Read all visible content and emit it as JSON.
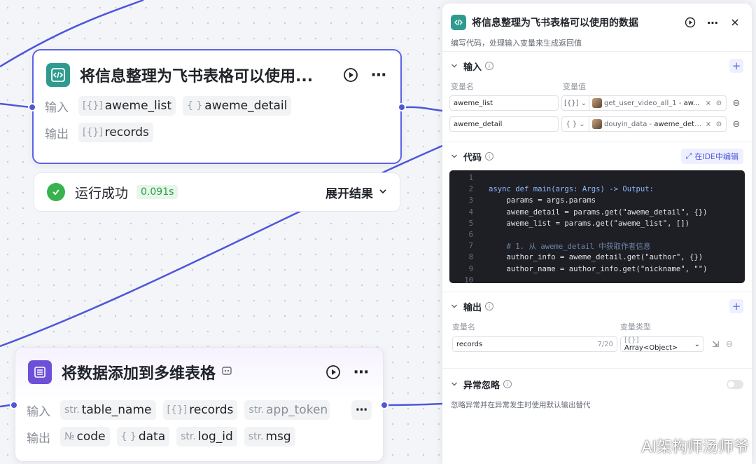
{
  "colors": {
    "accent": "#4e57d8",
    "success": "#37b24d",
    "code_icon": "#2f9b8f",
    "table_icon": "#6e4fd8"
  },
  "node_code": {
    "title": "将信息整理为飞书表格可以使用...",
    "input_label": "输入",
    "output_label": "输出",
    "inputs": [
      {
        "type_icon": "[{}]",
        "name": "aweme_list"
      },
      {
        "type_icon": "{ }",
        "name": "aweme_detail"
      }
    ],
    "outputs": [
      {
        "type_icon": "[{}]",
        "name": "records"
      }
    ]
  },
  "run_status": {
    "text": "运行成功",
    "time": "0.091s",
    "expand_label": "展开结果"
  },
  "node_table": {
    "title": "将数据添加到多维表格",
    "input_label": "输入",
    "output_label": "输出",
    "inputs": [
      {
        "type_icon": "str.",
        "name": "table_name"
      },
      {
        "type_icon": "[{}]",
        "name": "records"
      },
      {
        "type_icon": "str.",
        "name": "app_token"
      }
    ],
    "outputs": [
      {
        "type_icon": "№",
        "name": "code"
      },
      {
        "type_icon": "{ }",
        "name": "data"
      },
      {
        "type_icon": "str.",
        "name": "log_id"
      },
      {
        "type_icon": "str.",
        "name": "msg"
      }
    ]
  },
  "panel": {
    "title": "将信息整理为飞书表格可以使用的数据",
    "description": "编写代码，处理输入变量来生成返回值",
    "input_section": {
      "title": "输入",
      "col_name": "变量名",
      "col_value": "变量值",
      "rows": [
        {
          "name": "aweme_list",
          "type_icon": "[{}]",
          "ref_source": "get_user_video_all_1 - ",
          "ref_var": "aw..."
        },
        {
          "name": "aweme_detail",
          "type_icon": "{ }",
          "ref_source": "douyin_data - ",
          "ref_var": "aweme_detail"
        }
      ]
    },
    "code_section": {
      "title": "代码",
      "ide_label": "在IDE中编辑",
      "lines": [
        "",
        "async def main(args: Args) -> Output:",
        "    params = args.params",
        "    aweme_detail = params.get(\"aweme_detail\", {})",
        "    aweme_list = params.get(\"aweme_list\", [])",
        "",
        "    # 1. 从 aweme_detail 中获取作者信息",
        "    author_info = aweme_detail.get(\"author\", {})",
        "    author_name = author_info.get(\"nickname\", \"\")",
        ""
      ]
    },
    "output_section": {
      "title": "输出",
      "col_name": "变量名",
      "col_type": "变量类型",
      "rows": [
        {
          "name": "records",
          "count": "7/20",
          "type": "Array<Object>"
        }
      ]
    },
    "exception_section": {
      "title": "异常忽略",
      "description": "忽略异常并在异常发生时使用默认输出替代"
    }
  },
  "watermark": "AI架构师汤师爷"
}
